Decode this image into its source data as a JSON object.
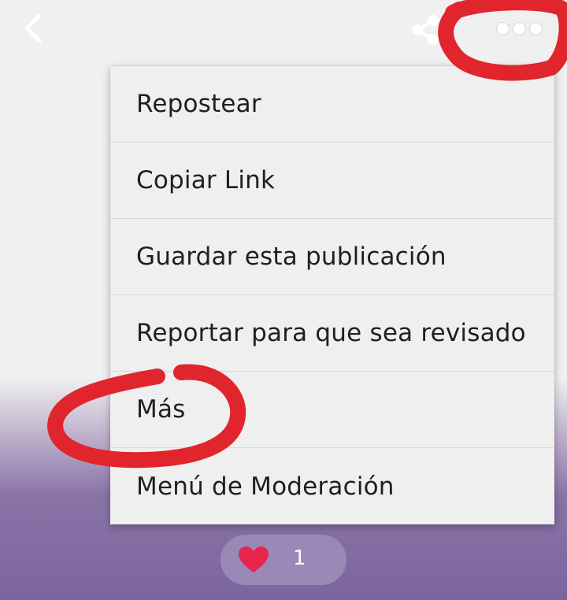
{
  "header": {
    "back_icon": "chevron-left-icon",
    "share_icon": "share-icon",
    "more_icon": "more-horizontal-icon"
  },
  "menu": {
    "items": [
      {
        "label": "Repostear"
      },
      {
        "label": "Copiar Link"
      },
      {
        "label": "Guardar esta publicación"
      },
      {
        "label": "Reportar para que sea revisado"
      },
      {
        "label": "Más"
      },
      {
        "label": "Menú de Moderación"
      }
    ]
  },
  "like": {
    "icon": "heart-icon",
    "count": "1"
  },
  "colors": {
    "annotation_red": "#e0262c",
    "purple_bg": "#7c659e",
    "heart": "#e8254e"
  }
}
